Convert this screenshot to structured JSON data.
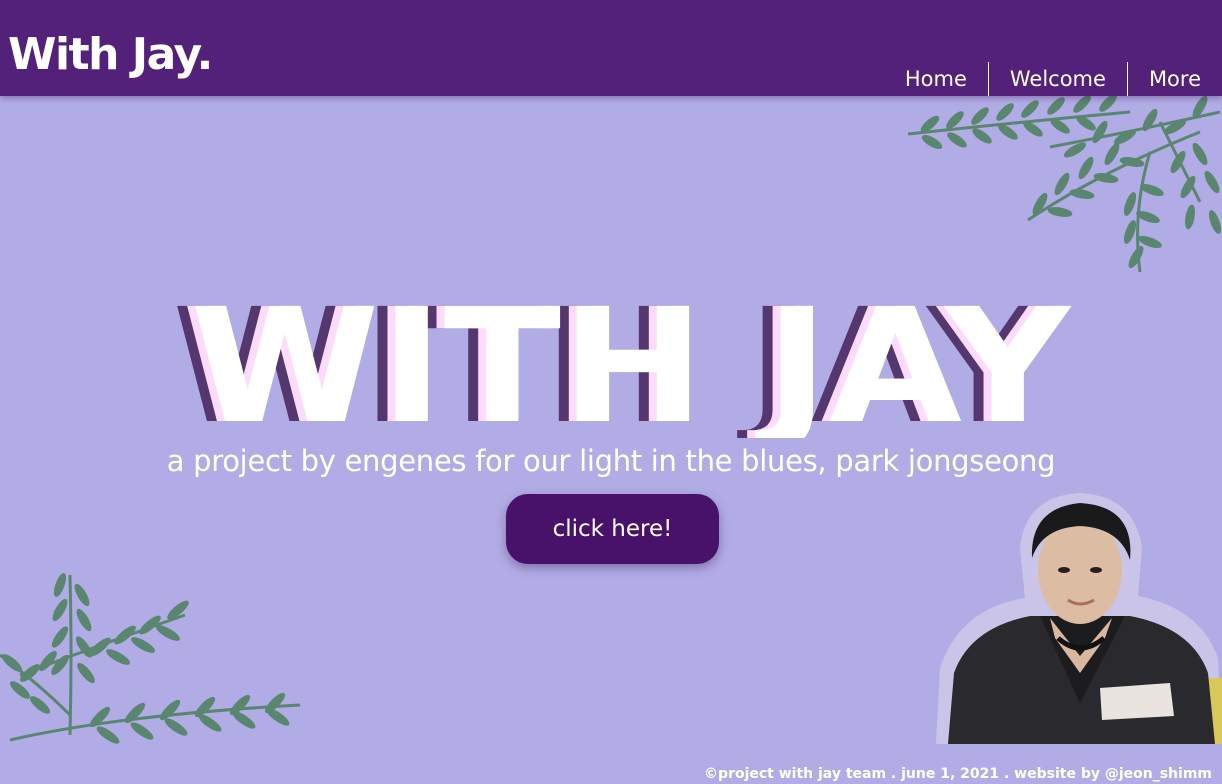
{
  "header": {
    "logo": "With Jay.",
    "nav": [
      {
        "label": "Home"
      },
      {
        "label": "Welcome"
      },
      {
        "label": "More"
      }
    ]
  },
  "hero": {
    "title": "WITH JAY",
    "tagline": "a project by engenes for our light in the blues, park jongseong",
    "cta_label": "click here!"
  },
  "footer": {
    "text": "©project with jay team . june 1, 2021 . website by @jeon_shimm"
  },
  "colors": {
    "header_bg": "#53217a",
    "page_bg": "#b2ace6",
    "button_bg": "#48116a",
    "title_shadow_dark": "#56366f",
    "title_shadow_pink": "#fddcfb",
    "leaf_green": "#5a8670"
  },
  "icons": {
    "top_right_decoration": "leaf-branch-icon",
    "bottom_left_decoration": "leaf-branch-icon"
  }
}
